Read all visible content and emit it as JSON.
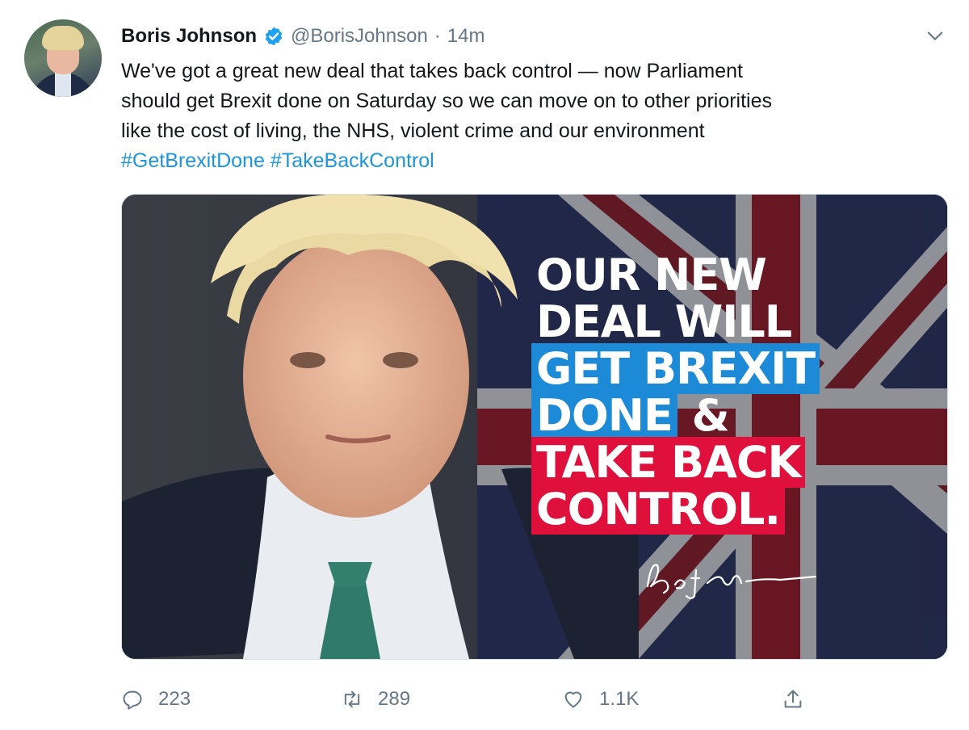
{
  "tweet": {
    "display_name": "Boris Johnson",
    "verified": true,
    "handle": "@BorisJohnson",
    "separator": "·",
    "time": "14m",
    "text_lines": [
      "We've got a great new deal that takes back control — now Parliament",
      "should get Brexit done on Saturday so we can move on to other priorities",
      "like the cost of living, the NHS, violent crime and our environment"
    ],
    "hashtags": [
      "#GetBrexitDone",
      "#TakeBackControl"
    ],
    "media": {
      "slogan_lines": [
        "OUR NEW",
        "DEAL WILL",
        "GET BREXIT",
        "DONE",
        "&",
        "TAKE BACK",
        "CONTROL."
      ],
      "signature_text": "Boris Johnson",
      "colors": {
        "blue_highlight": "#1c8ad6",
        "red_highlight": "#e0103d"
      }
    },
    "actions": {
      "reply_count": "223",
      "retweet_count": "289",
      "like_count": "1.1K"
    },
    "icons": {
      "verified": "verified-badge-icon",
      "caret": "chevron-down-icon",
      "reply": "reply-icon",
      "retweet": "retweet-icon",
      "like": "heart-icon",
      "share": "share-icon"
    },
    "accent_color": "#1b95e0"
  }
}
